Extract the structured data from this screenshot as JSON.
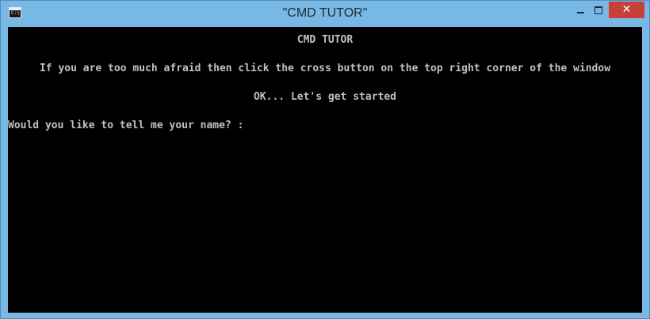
{
  "window": {
    "title": "\"CMD TUTOR\"",
    "icon": "console-icon",
    "icon_text": "C:\\",
    "controls": {
      "minimize": "minimize-icon",
      "maximize": "maximize-icon",
      "close_glyph": "✕"
    }
  },
  "console": {
    "heading": "CMD TUTOR",
    "warning": "If you are too much afraid then click the cross button on the top right corner of the window",
    "ok_line": "OK... Let's get started",
    "prompt": "Would you like to tell me your name? :"
  },
  "colors": {
    "titlebar": "#78b8e4",
    "close_button": "#c7403a",
    "console_background": "#000000",
    "console_text": "#c0c0c0"
  }
}
